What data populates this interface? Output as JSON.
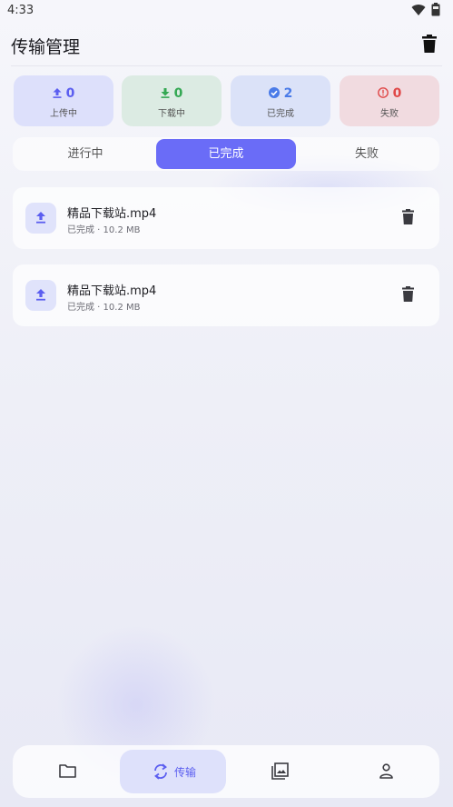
{
  "status": {
    "time": "4:33"
  },
  "header": {
    "title": "传输管理"
  },
  "stats": [
    {
      "count": "0",
      "label": "上传中",
      "color": "#5b5ef0",
      "bg": "#dde0fb"
    },
    {
      "count": "0",
      "label": "下载中",
      "color": "#34a853",
      "bg": "#dcebe3"
    },
    {
      "count": "2",
      "label": "已完成",
      "color": "#4a7be8",
      "bg": "#dbe2f8"
    },
    {
      "count": "0",
      "label": "失败",
      "color": "#e04848",
      "bg": "#f1dbe0"
    }
  ],
  "tabs": [
    {
      "label": "进行中"
    },
    {
      "label": "已完成"
    },
    {
      "label": "失败"
    }
  ],
  "active_tab": 1,
  "transfers": [
    {
      "name": "精品下载站.mp4",
      "meta": "已完成 · 10.2 MB"
    },
    {
      "name": "精品下载站.mp4",
      "meta": "已完成 · 10.2 MB"
    }
  ],
  "nav": [
    {
      "icon": "folder-icon"
    },
    {
      "icon": "sync-icon",
      "label": "传输"
    },
    {
      "icon": "gallery-icon"
    },
    {
      "icon": "person-icon"
    }
  ],
  "colors": {
    "accent": "#6a6cf7"
  }
}
